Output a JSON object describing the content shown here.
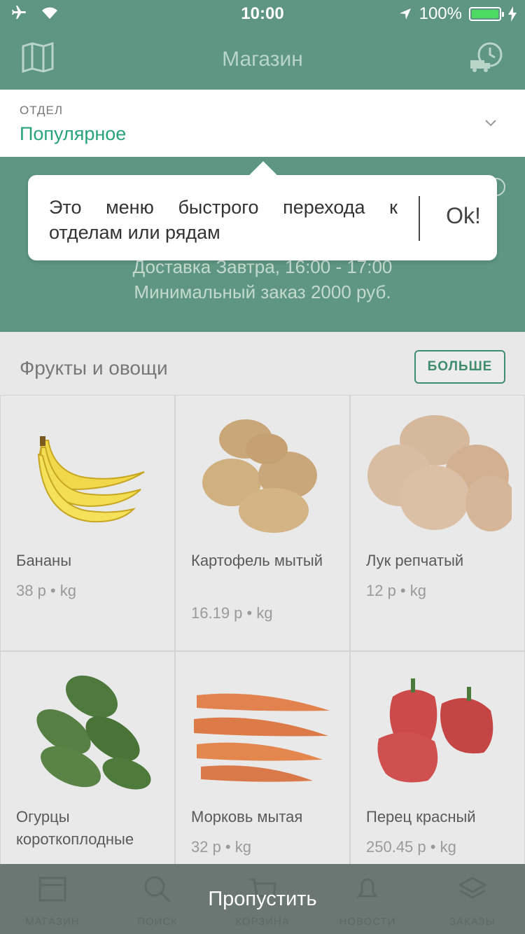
{
  "status_bar": {
    "time": "10:00",
    "battery": "100%",
    "battery_level": 1.0
  },
  "nav": {
    "title": "Магазин",
    "left_icon": "map-icon",
    "right_icon": "delivery-history-icon"
  },
  "department": {
    "label": "ОТДЕЛ",
    "value": "Популярное"
  },
  "store": {
    "line1": "Доставка Завтра, 16:00 - 17:00",
    "line2": "Минимальный заказ 2000 руб."
  },
  "tooltip": {
    "text": "Это меню быстрого перехода к отделам или рядам",
    "ok": "Ok!"
  },
  "category": {
    "title": "Фрукты и овощи",
    "more": "БОЛЬШЕ"
  },
  "products": [
    {
      "name": "Бананы",
      "price": "38 р • kg",
      "icon": "banana-image"
    },
    {
      "name": "Картофель мытый",
      "price": "16.19 р • kg",
      "icon": "potato-image"
    },
    {
      "name": "Лук репчатый",
      "price": "12 р • kg",
      "icon": "onion-image"
    },
    {
      "name": "Огурцы короткоплодные",
      "price": "",
      "icon": "cucumber-image"
    },
    {
      "name": "Морковь мытая",
      "price": "32 р • kg",
      "icon": "carrot-image"
    },
    {
      "name": "Перец красный",
      "price": "250.45 р • kg",
      "icon": "pepper-image"
    }
  ],
  "tabs": [
    {
      "label": "МАГАЗИН",
      "icon": "store-icon"
    },
    {
      "label": "ПОИСК",
      "icon": "search-icon"
    },
    {
      "label": "КОРЗИНА",
      "icon": "cart-icon"
    },
    {
      "label": "НОВОСТИ",
      "icon": "bell-icon"
    },
    {
      "label": "ЗАКАЗЫ",
      "icon": "orders-icon"
    }
  ],
  "skip": "Пропустить",
  "colors": {
    "accent": "#29a37c",
    "nav_dimmed": "#5e9683",
    "overlay_bar": "#6b7772"
  }
}
